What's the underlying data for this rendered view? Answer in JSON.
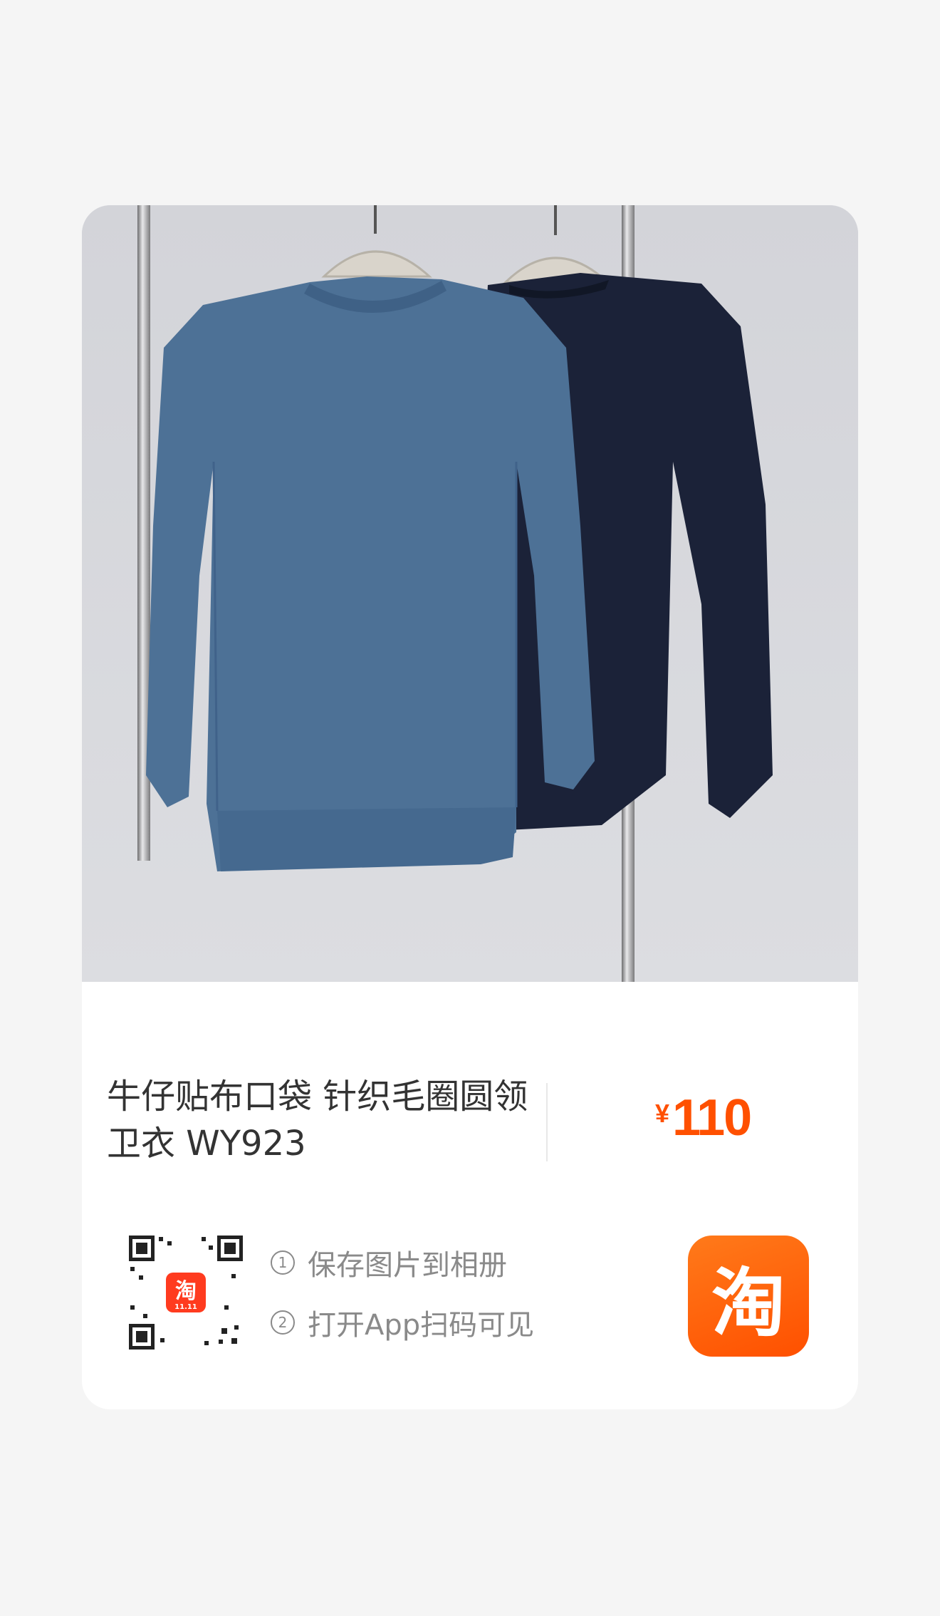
{
  "product": {
    "title": "牛仔贴布口袋 针织毛圈圆领卫衣 WY923",
    "currency": "¥",
    "price": "110",
    "colors": [
      "#4d7196",
      "#1b2238"
    ]
  },
  "share": {
    "qr_badge": {
      "glyph": "淘",
      "caption": "11.11"
    },
    "steps": [
      {
        "num": "1",
        "text": "保存图片到相册"
      },
      {
        "num": "2",
        "text": "打开App扫码可见"
      }
    ],
    "logo_glyph": "淘"
  },
  "colors": {
    "accent": "#ff5000",
    "card": "#ffffff",
    "page": "#f5f5f5"
  }
}
